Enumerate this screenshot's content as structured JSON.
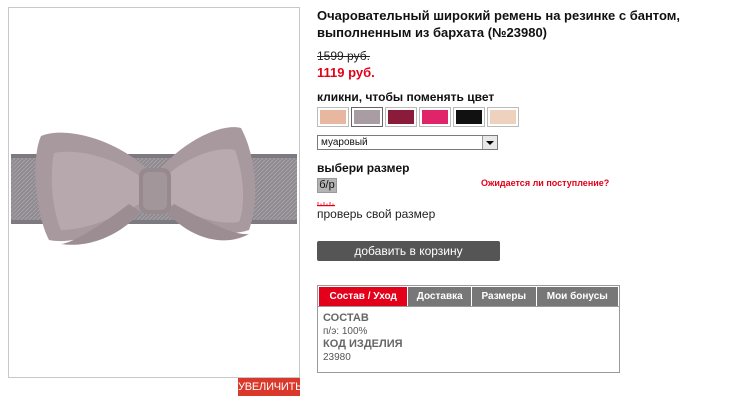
{
  "product": {
    "title": "Очаровательный широкий ремень на резинке с бантом, выполненным из бархата (№23980)",
    "old_price": "1599 руб.",
    "new_price": "1119 руб.",
    "zoom_label": "УВЕЛИЧИТЬ"
  },
  "color": {
    "heading": "кликни, чтобы поменять цвет",
    "swatches": [
      {
        "color": "#e8b7a0",
        "name": "peach"
      },
      {
        "color": "#a99da3",
        "name": "mauve"
      },
      {
        "color": "#8a1b3a",
        "name": "burgundy"
      },
      {
        "color": "#e0246a",
        "name": "pink"
      },
      {
        "color": "#111111",
        "name": "black"
      },
      {
        "color": "#efd2bd",
        "name": "nude"
      }
    ],
    "selected_value": "муаровый"
  },
  "size": {
    "heading": "выбери размер",
    "option": "б/р",
    "awaiting_link": "Ожидается ли поступление?",
    "check_size_link": "проверь свой размер"
  },
  "cart": {
    "add_label": "добавить в корзину"
  },
  "tabs": {
    "items": [
      {
        "label": "Состав / Уход",
        "active": true
      },
      {
        "label": "Доставка",
        "active": false
      },
      {
        "label": "Размеры",
        "active": false
      },
      {
        "label": "Мои бонусы",
        "active": false
      }
    ],
    "content": {
      "composition_heading": "СОСТАВ",
      "composition_value": "п/э: 100%",
      "code_heading": "КОД ИЗДЕЛИЯ",
      "code_value": "23980"
    }
  }
}
